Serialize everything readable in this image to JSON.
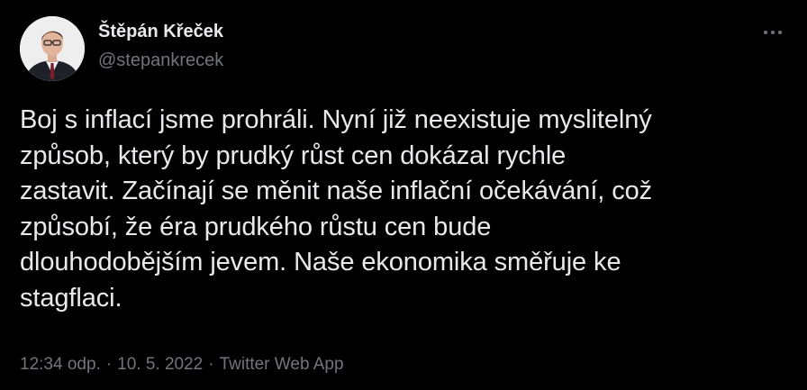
{
  "author": {
    "display_name": "Štěpán Křeček",
    "handle": "@stepankrecek"
  },
  "tweet": {
    "text": "Boj s inflací jsme prohráli. Nyní již neexistuje myslitelný\nzpůsob, který by prudký růst cen dokázal rychle\nzastavit. Začínají se měnit naše inflační očekávání, což\nzpůsobí, že éra prudkého růstu cen bude\ndlouhodobějším jevem. Naše ekonomika směřuje ke\nstagflaci."
  },
  "meta": {
    "time": "12:34 odp.",
    "separator": "·",
    "date": "10. 5. 2022",
    "source": "Twitter Web App"
  },
  "icons": {
    "more": "more-horizontal-icon"
  },
  "colors": {
    "background": "#000000",
    "primary_text": "#e7e9ea",
    "secondary_text": "#71767b"
  }
}
